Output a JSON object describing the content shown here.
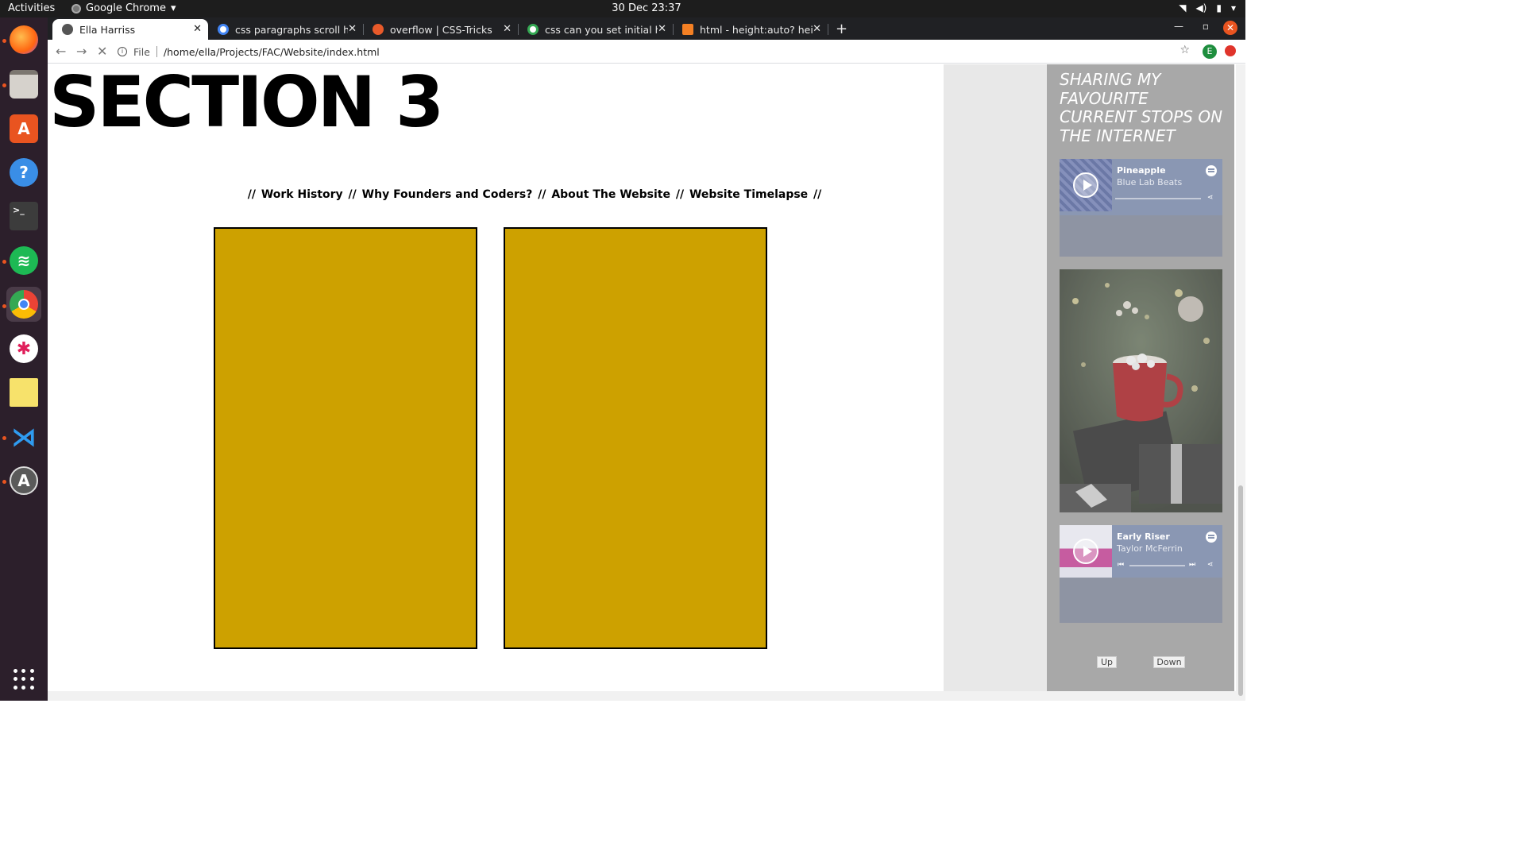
{
  "system": {
    "activities": "Activities",
    "app_name": "Google Chrome",
    "clock": "30 Dec  23:37"
  },
  "tabs": [
    {
      "title": "Ella Harriss",
      "active": true
    },
    {
      "title": "css paragraphs scroll hidden",
      "active": false
    },
    {
      "title": "overflow | CSS-Tricks",
      "active": false
    },
    {
      "title": "css can you set initial height",
      "active": false
    },
    {
      "title": "html - height:auto? height",
      "active": false
    }
  ],
  "address_bar": {
    "scheme": "File",
    "url": "/home/ella/Projects/FAC/Website/index.html"
  },
  "profile_initial": "E",
  "page": {
    "section_title": "SECTION 3",
    "nav_links": [
      "//",
      "Work History",
      "//",
      "Why Founders and Coders?",
      "//",
      "About The Website",
      "//",
      "Website Timelapse",
      "//"
    ]
  },
  "sidebar": {
    "title": "SHARING MY FAVOURITE CURRENT STOPS ON THE INTERNET",
    "players": [
      {
        "track": "Pineapple",
        "artist": "Blue Lab Beats"
      },
      {
        "track": "Early Riser",
        "artist": "Taylor McFerrin"
      }
    ],
    "up_label": "Up",
    "down_label": "Down"
  },
  "colors": {
    "card": "#cda100",
    "sidebar": "#a8a8a8",
    "player": "#8a97b3",
    "dock": "#2c1f2b"
  }
}
